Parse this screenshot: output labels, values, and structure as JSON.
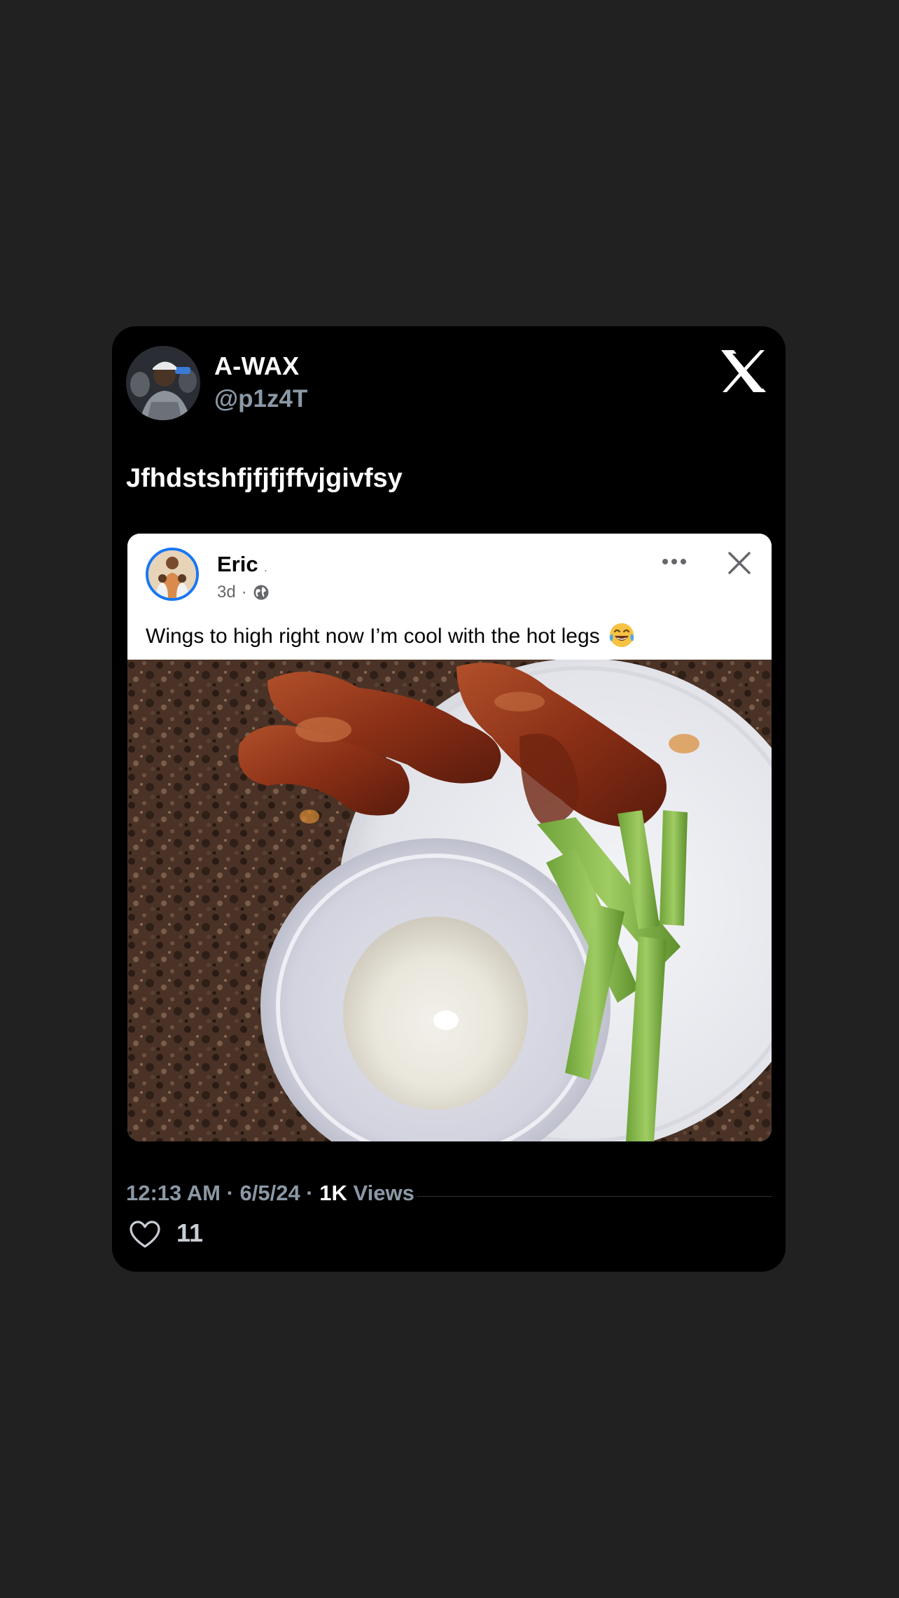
{
  "tweet": {
    "author_name": "A-WAX",
    "author_handle": "@p1z4T",
    "text": "Jfhdstshfjfjfjffvjgivfsy",
    "timestamp": "12:13 AM · 6/5/24 · ",
    "views_count": "1K",
    "views_label": " Views",
    "like_count": "11",
    "icons": [
      "x-logo-icon",
      "heart-icon"
    ]
  },
  "embedded_post": {
    "author_name": "Eric",
    "author_suffix": ".",
    "time": "3d",
    "separator": "·",
    "caption": "Wings to high right now I’m cool with the hot legs",
    "icons": [
      "globe-icon",
      "more-icon",
      "close-icon",
      "laughing-emoji-icon"
    ]
  },
  "colors": {
    "page_bg": "#212121",
    "card_bg": "#000000",
    "muted_text": "#8b98a5",
    "fb_blue": "#1877f2"
  }
}
